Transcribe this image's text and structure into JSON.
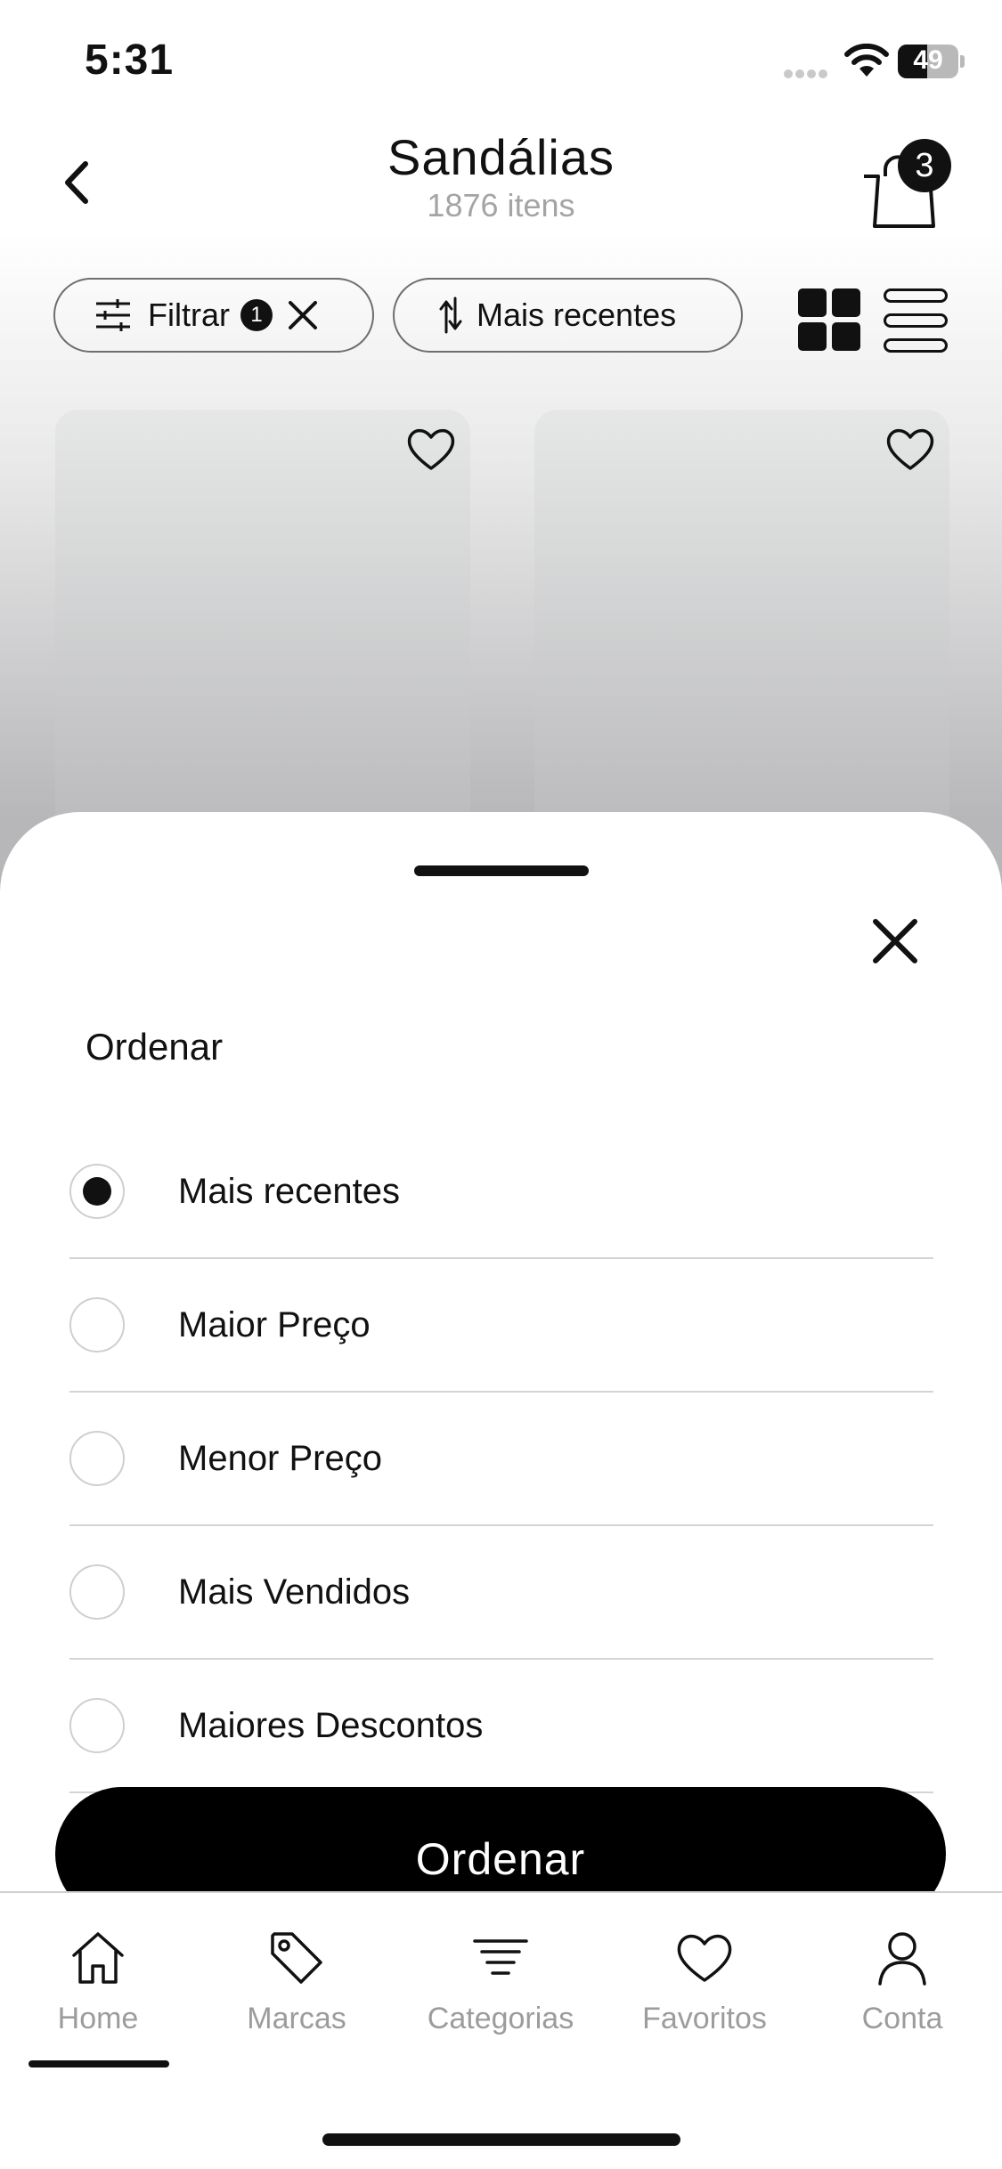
{
  "status_bar": {
    "time": "5:31",
    "battery_level": "49",
    "battery_fraction": 0.49
  },
  "header": {
    "title": "Sandálias",
    "item_count": "1876 itens",
    "cart_badge": "3"
  },
  "toolbar": {
    "filter_label": "Filtrar",
    "filter_count": "1",
    "sort_label": "Mais recentes"
  },
  "products": [
    {
      "favorite": false,
      "image_tone": "#d9cdb8"
    },
    {
      "favorite": false,
      "image_tone": "#1a1a1a"
    }
  ],
  "sort_sheet": {
    "title": "Ordenar",
    "selected": "Mais recentes",
    "options": [
      {
        "label": "Mais recentes",
        "checked": true
      },
      {
        "label": "Maior Preço",
        "checked": false
      },
      {
        "label": "Menor Preço",
        "checked": false
      },
      {
        "label": "Mais Vendidos",
        "checked": false
      },
      {
        "label": "Maiores Descontos",
        "checked": false
      }
    ],
    "apply_label": "Ordenar"
  },
  "tab_bar": {
    "active": "Home",
    "items": [
      {
        "label": "Home",
        "icon": "home-icon"
      },
      {
        "label": "Marcas",
        "icon": "tag-icon"
      },
      {
        "label": "Categorias",
        "icon": "list-filter-icon"
      },
      {
        "label": "Favoritos",
        "icon": "heart-icon"
      },
      {
        "label": "Conta",
        "icon": "user-icon"
      }
    ]
  },
  "colors": {
    "accent": "#000000",
    "muted_text": "#9c9c9c",
    "divider": "#d4d4d4"
  }
}
